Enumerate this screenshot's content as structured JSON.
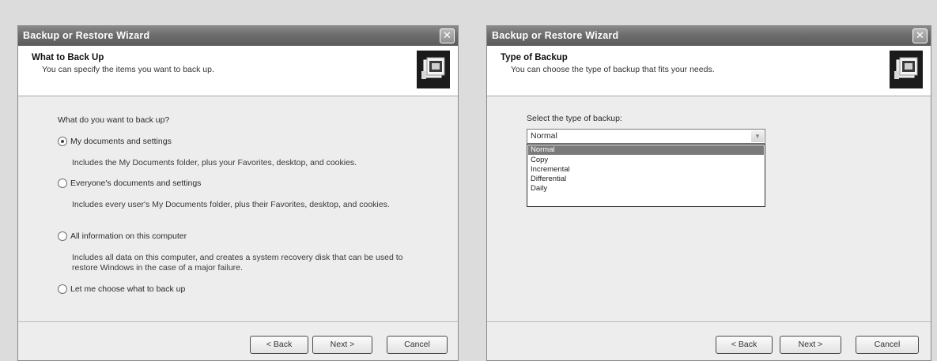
{
  "left_wizard": {
    "title": "Backup or Restore Wizard",
    "close_glyph": "✕",
    "header_title": "What to Back Up",
    "header_subtitle": "You can specify the items you want to back up.",
    "header_icon": "backup-wizard-icon",
    "question": "What do you want to back up?",
    "options": [
      {
        "label": "My documents and settings",
        "checked": true,
        "description": "Includes the My Documents folder, plus your Favorites, desktop, and cookies."
      },
      {
        "label": "Everyone's documents and settings",
        "checked": false,
        "description": "Includes every user's My Documents folder, plus their Favorites, desktop, and cookies."
      },
      {
        "label": "All information on this computer",
        "checked": false,
        "description": "Includes all data on this computer, and creates a system recovery disk that can be used to restore Windows in the case of a major failure."
      },
      {
        "label": "Let me choose what to back up",
        "checked": false,
        "description": ""
      }
    ],
    "buttons": {
      "back": "< Back",
      "next": "Next >",
      "cancel": "Cancel"
    }
  },
  "right_wizard": {
    "title": "Backup or Restore Wizard",
    "close_glyph": "✕",
    "header_title": "Type of Backup",
    "header_subtitle": "You can choose the type of backup that fits your needs.",
    "header_icon": "backup-wizard-icon",
    "select_label": "Select the type of backup:",
    "selected_value": "Normal",
    "dropdown_arrow": "▼",
    "options": [
      "Normal",
      "Copy",
      "Incremental",
      "Differential",
      "Daily"
    ],
    "highlighted_option": "Normal",
    "buttons": {
      "back": "< Back",
      "next": "Next >",
      "cancel": "Cancel"
    }
  }
}
